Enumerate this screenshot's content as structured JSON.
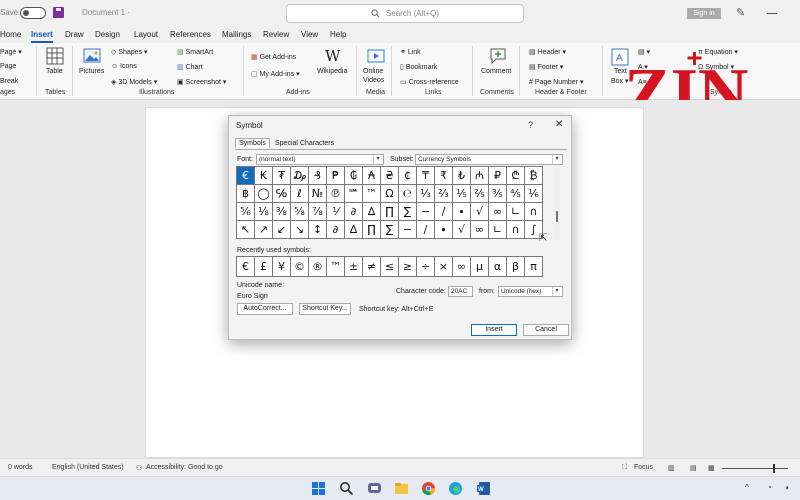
{
  "titlebar": {
    "autosave": "Save",
    "document": "Document 1  ·",
    "search_placeholder": "Search (Alt+Q)",
    "signin": "Sign in"
  },
  "menu": {
    "tabs": [
      "Home",
      "Insert",
      "Draw",
      "Design",
      "Layout",
      "References",
      "Mailings",
      "Review",
      "View",
      "Help"
    ],
    "active": "Insert"
  },
  "ribbon": {
    "pages": [
      "Page ▾",
      "Page",
      "Break"
    ],
    "pages_group": "ages",
    "table": "Table",
    "table_group": "Tables",
    "pictures": "Pictures",
    "shapes": "Shapes ▾",
    "icons": "Icons",
    "models": "3D Models ▾",
    "smartart": "SmartArt",
    "chart": "Chart",
    "screenshot": "Screenshot ▾",
    "illustrations_group": "Illustrations",
    "get_addins": "Get Add-ins",
    "my_addins": "My Add-ins ▾",
    "wikipedia": "Wikipedia",
    "addins_group": "Add-ins",
    "online_videos": [
      "Online",
      "Videos"
    ],
    "media_group": "Media",
    "link": "Link",
    "bookmark": "Bookmark",
    "crossref": "Cross-reference",
    "links_group": "Links",
    "comment": "Comment",
    "comments_group": "Comments",
    "header": "Header ▾",
    "footer": "Footer ▾",
    "pagenum": "Page Number ▾",
    "hf_group": "Header & Footer",
    "textbox": [
      "Text",
      "Box ▾"
    ],
    "equation": "Equation ▾",
    "symbol": "Symbol ▾",
    "symbols_group": "Symbo"
  },
  "dialog": {
    "title": "Symbol",
    "help": "?",
    "close": "✕",
    "tab_symbols": "Symbols",
    "tab_special": "Special Characters",
    "font_label": "Font:",
    "font_value": "(normal text)",
    "subset_label": "Subset:",
    "subset_value": "Currency Symbols",
    "symbols": [
      "€",
      "₭",
      "₮",
      "₯",
      "₰",
      "₱",
      "₲",
      "₳",
      "₴",
      "₵",
      "₸",
      "₹",
      "₺",
      "₼",
      "₽",
      "₾",
      "₿",
      "฿",
      "◯",
      "℅",
      "ℓ",
      "№",
      "℗",
      "℠",
      "™",
      "Ω",
      "℮",
      "⅓",
      "⅔",
      "⅕",
      "⅖",
      "⅗",
      "⅘",
      "⅙",
      "⅚",
      "⅛",
      "⅜",
      "⅝",
      "⅞",
      "⅟",
      "∂",
      "∆",
      "∏",
      "∑",
      "−",
      "∕",
      "∙",
      "√",
      "∞",
      "∟",
      "∩",
      "↖",
      "↗",
      "↙",
      "↘",
      "↕",
      "∂",
      "∆",
      "∏",
      "∑",
      "−",
      "∕",
      "∙",
      "√",
      "∞",
      "∟",
      "∩",
      "∫"
    ],
    "selected_index": 0,
    "recent_label": "Recently used symbols:",
    "recent": [
      "€",
      "£",
      "¥",
      "©",
      "®",
      "™",
      "±",
      "≠",
      "≤",
      "≥",
      "÷",
      "×",
      "∞",
      "µ",
      "α",
      "β",
      "π"
    ],
    "unicode_name_label": "Unicode name:",
    "unicode_name": "Euro Sign",
    "char_code_label": "Character code:",
    "char_code": "20AC",
    "from_label": "from:",
    "from_value": "Unicode (hex)",
    "autocorrect": "AutoCorrect...",
    "shortcut_key": "Shortcut Key...",
    "shortcut_text": "Shortcut key: Alt+Ctrl+E",
    "insert": "Insert",
    "cancel": "Cancel"
  },
  "status": {
    "words": "0 words",
    "language": "English (United States)",
    "accessibility": "Accessibility: Good to go",
    "focus": "Focus"
  },
  "logo": {
    "text": "ZIN",
    "color": "#d6141f"
  }
}
